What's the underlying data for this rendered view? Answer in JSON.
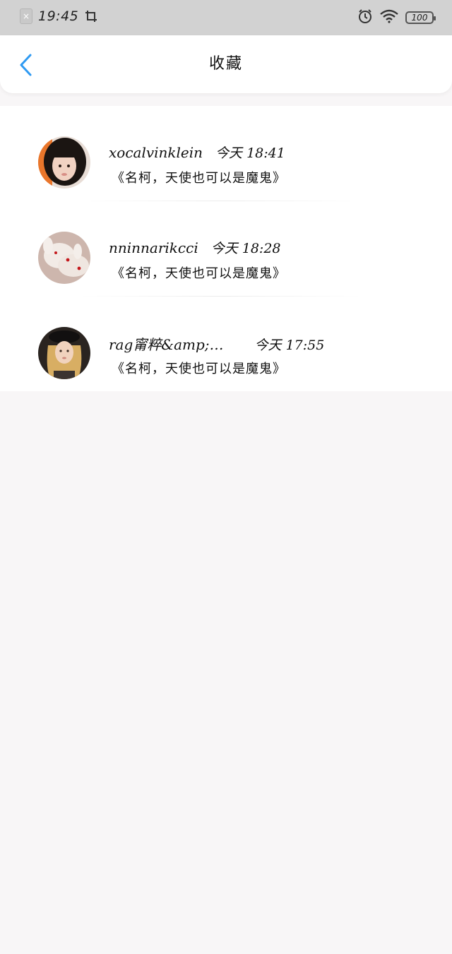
{
  "status_bar": {
    "time": "19:45",
    "battery": "100",
    "icons": [
      "sim-icon",
      "crop-icon",
      "alarm-icon",
      "wifi-icon",
      "battery-icon"
    ]
  },
  "header": {
    "title": "收藏",
    "back_icon": "chevron-left-icon",
    "accent_color": "#2f9af2"
  },
  "favorites": [
    {
      "username": "xocalvinklein",
      "time": "今天 18:41",
      "subtitle": "《名柯，天使也可以是魔鬼》",
      "avatar": "girl-portrait"
    },
    {
      "username": "nninnarikcci",
      "time": "今天 18:28",
      "subtitle": "《名柯，天使也可以是魔鬼》",
      "avatar": "white-rabbits"
    },
    {
      "username": "rag甯粹&amp;…",
      "time": "今天 17:55",
      "subtitle": "《名柯，天使也可以是魔鬼》",
      "avatar": "blonde-woman"
    }
  ]
}
